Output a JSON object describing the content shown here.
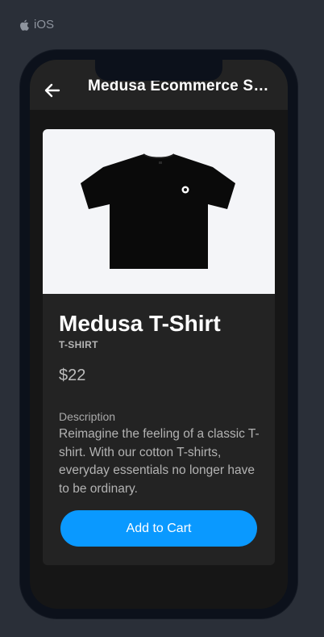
{
  "platform": {
    "icon": "apple-icon",
    "label": "iOS"
  },
  "header": {
    "back_icon": "arrow-left-icon",
    "title": "Medusa Ecommerce Store"
  },
  "product": {
    "image_icon": "tshirt-image",
    "name": "Medusa T-Shirt",
    "type": "T-SHIRT",
    "price": "$22",
    "description_label": "Description",
    "description": "Reimagine the feeling of a classic T-shirt. With our cotton T-shirts, everyday essentials no longer have to be ordinary.",
    "add_to_cart_label": "Add to Cart"
  },
  "colors": {
    "background": "#2a2f38",
    "screen": "#161616",
    "card": "#232323",
    "accent": "#0a99ff",
    "image_background": "#f4f5f8"
  }
}
